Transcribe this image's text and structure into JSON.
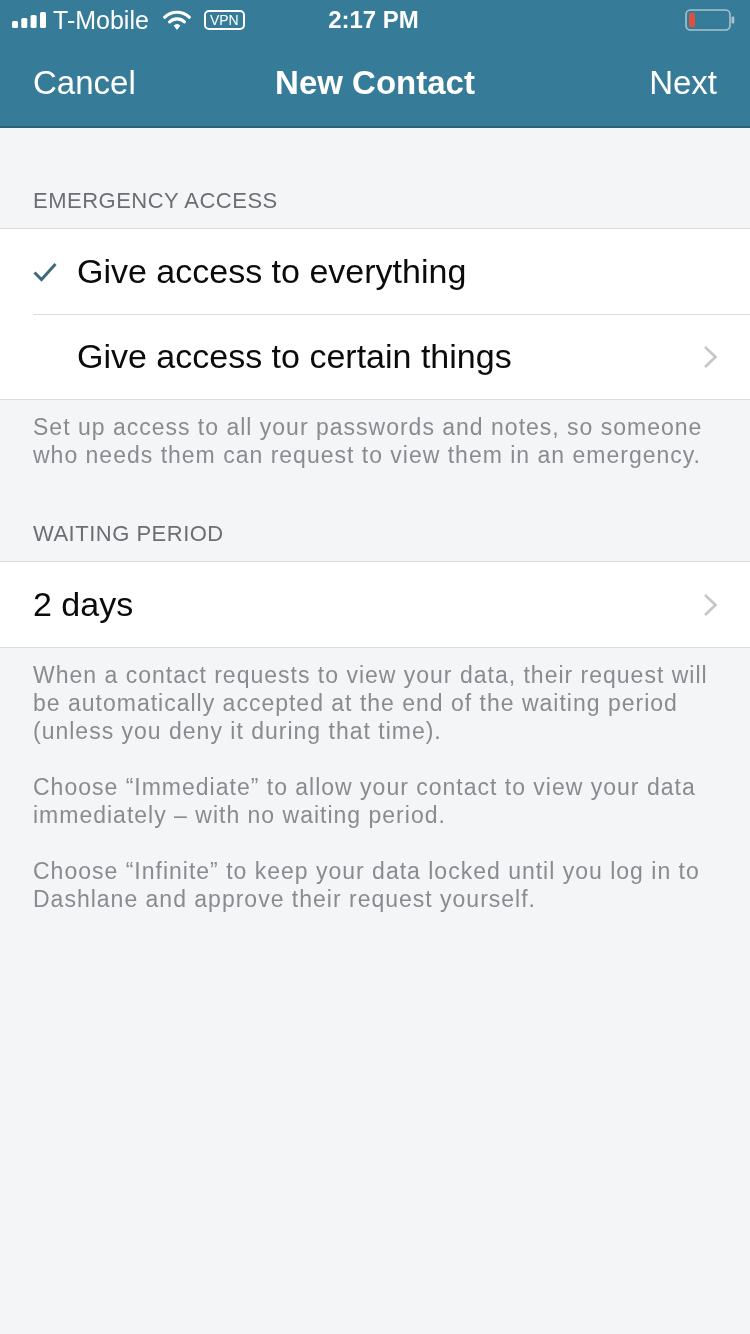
{
  "status_bar": {
    "carrier": "T-Mobile",
    "vpn": "VPN",
    "time": "2:17 PM"
  },
  "nav_bar": {
    "left_button": "Cancel",
    "title": "New Contact",
    "right_button": "Next"
  },
  "sections": [
    {
      "header": "EMERGENCY ACCESS",
      "rows": [
        {
          "kind": "choice",
          "label": "Give access to everything",
          "selected": true,
          "disclosure": false
        },
        {
          "kind": "choice",
          "label": "Give access to certain things",
          "selected": false,
          "disclosure": true
        }
      ],
      "footer": [
        "Set up access to all your passwords and notes, so someone who needs them can request to view them in an emergency."
      ]
    },
    {
      "header": "WAITING PERIOD",
      "rows": [
        {
          "kind": "picker",
          "label": "2 days",
          "disclosure": true
        }
      ],
      "footer": [
        "When a contact requests to view your data, their request will be automatically accepted at the end of the waiting period (unless you deny it during that time).",
        "Choose “Immediate” to allow your contact to view your data immediately – with no waiting period.",
        "Choose “Infinite” to keep your data locked until you log in to Dashlane and approve their request yourself."
      ]
    }
  ]
}
